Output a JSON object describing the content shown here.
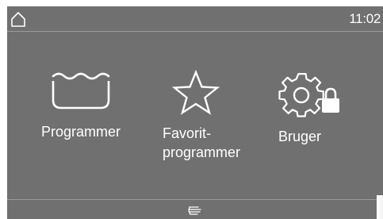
{
  "statusbar": {
    "home_icon": "home-icon",
    "time": "11:02"
  },
  "menu": {
    "items": [
      {
        "label": "Programmer",
        "icon": "wash-tub-icon"
      },
      {
        "label": "Favorit-\nprogrammer",
        "icon": "star-icon"
      },
      {
        "label": "Bruger",
        "icon": "gear-lock-icon"
      }
    ]
  },
  "footer": {
    "icon": "touch-sensor-icon"
  },
  "colors": {
    "screen_background": "#707070",
    "text": "#ffffff",
    "divider": "#9a9a9a"
  }
}
